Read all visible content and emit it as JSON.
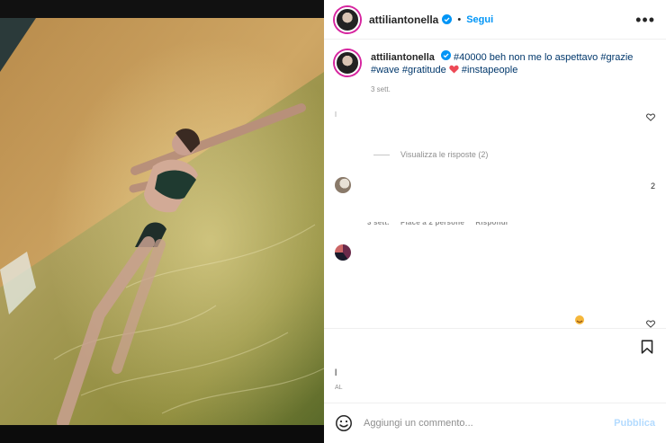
{
  "header": {
    "username": "attiliantonella",
    "separator": "•",
    "follow_label": "Segui",
    "more_icon": "more-horizontal-icon"
  },
  "caption": {
    "username": "attiliantonella",
    "text_before": "#40000 beh non me lo aspettavo",
    "tags_line1": "#grazie",
    "tags_line2a": "#wave",
    "tags_line2b": "#gratitude",
    "tags_line2c": "#instapeople",
    "time": "3 sett."
  },
  "comments": {
    "view_replies_label": "Visualizza le risposte (2)",
    "partial_count": "2",
    "meta_time": "3 sett.",
    "meta_likes": "Piace a 2 persone",
    "meta_reply": "Rispondi"
  },
  "footer": {
    "likes_fragment": "l",
    "ago_fragment": "AL",
    "comment_placeholder": "Aggiungi un commento...",
    "publish_label": "Pubblica"
  },
  "colors": {
    "accent": "#0095f6",
    "hashtag": "#00376b",
    "heart": "#ed4956",
    "publish_disabled": "#b3dbff"
  }
}
